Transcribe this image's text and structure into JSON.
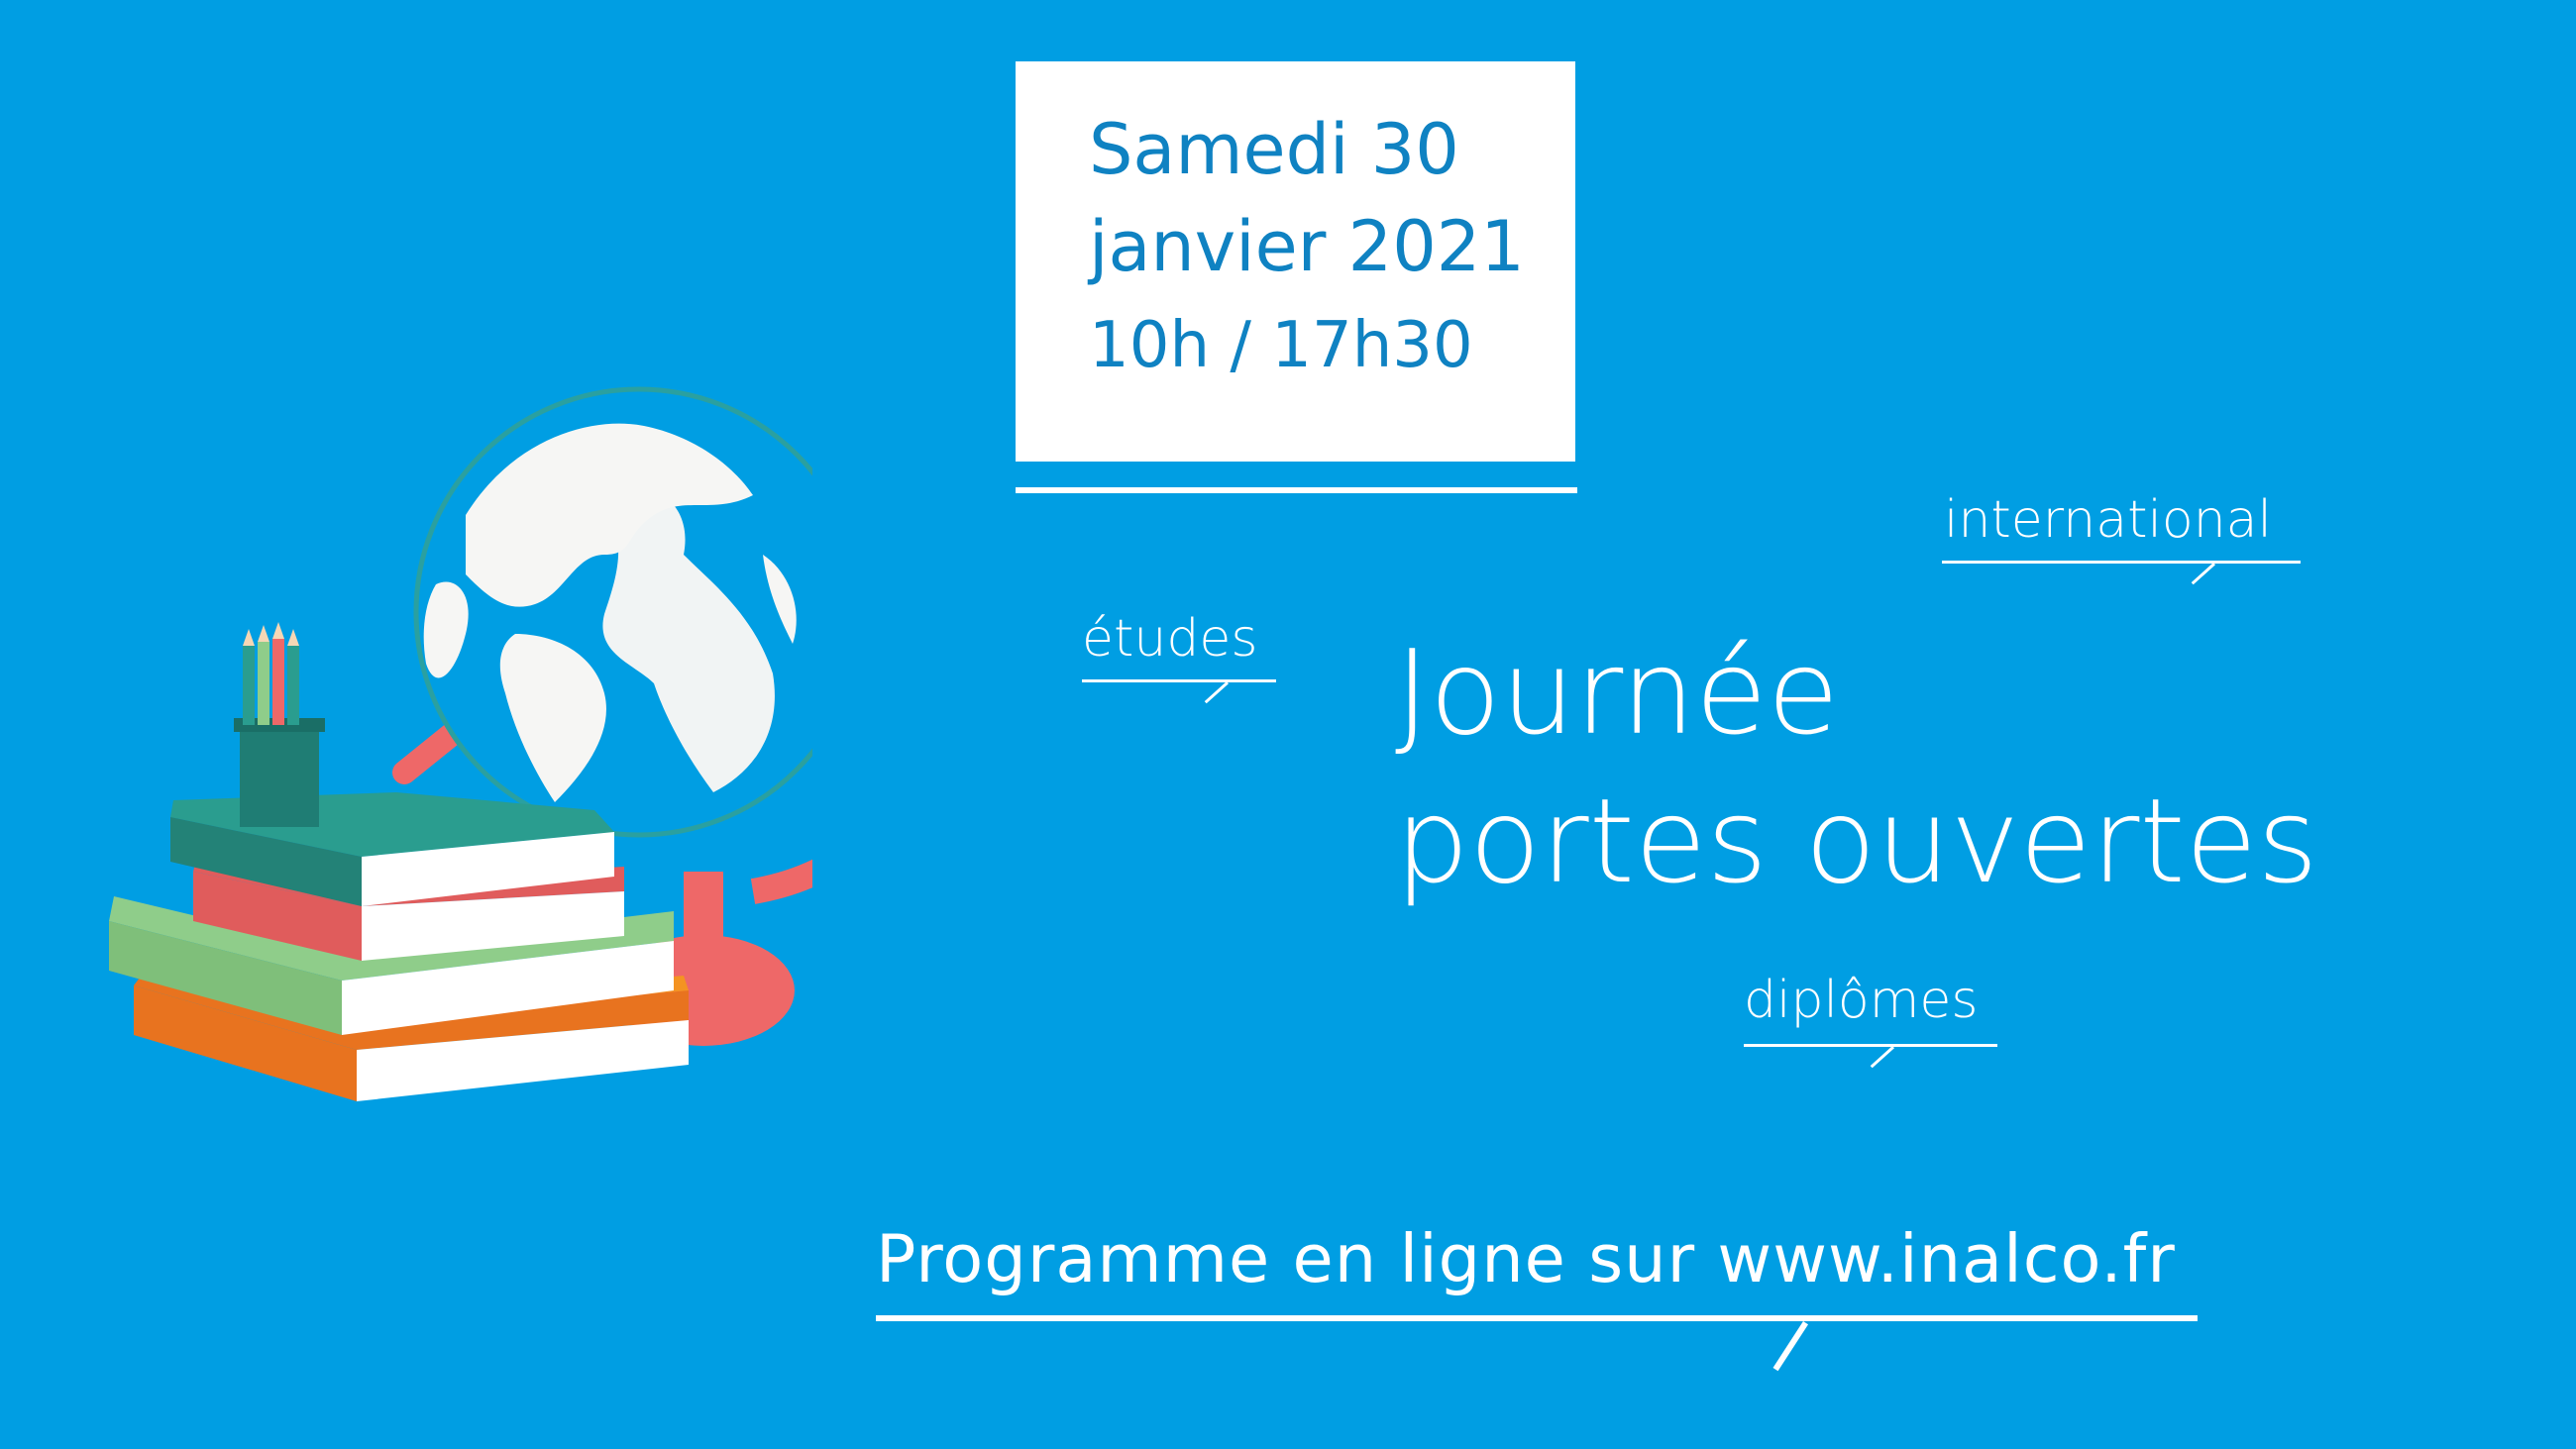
{
  "date_box": {
    "line1": "Samedi 30",
    "line2": "janvier 2021",
    "line3": "10h / 17h30"
  },
  "tags": {
    "international": "international",
    "etudes": "études",
    "diplomes": "diplômes"
  },
  "title": {
    "line1": "Journée",
    "line2": "portes ouvertes"
  },
  "footer": {
    "programme": "Programme en ligne sur www.inalco.fr"
  },
  "colors": {
    "background": "#009ee3",
    "date_text": "#0f82c2",
    "globe_stand": "#ee6868",
    "book_teal": "#2a9d8f",
    "book_green": "#8fcd8a",
    "book_orange": "#f49322"
  },
  "illustration": {
    "elements": [
      "globe-icon",
      "books-stack-icon",
      "pencil-cup-icon"
    ]
  }
}
